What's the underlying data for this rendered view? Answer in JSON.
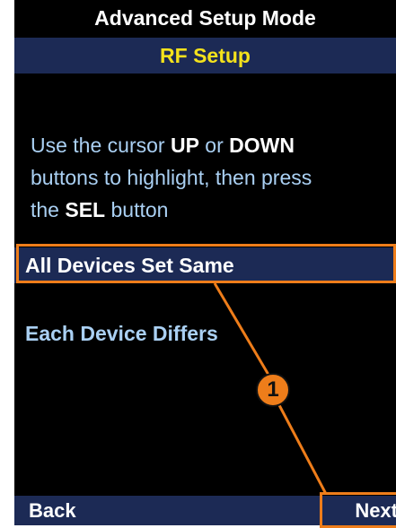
{
  "header": {
    "title": "Advanced Setup Mode",
    "subtitle": "RF Setup"
  },
  "instructions": {
    "line1_a": "Use the cursor ",
    "line1_up": "UP",
    "line1_or": " or ",
    "line1_down": "DOWN",
    "line2": "buttons to highlight, then press",
    "line3_a": "the ",
    "line3_sel": "SEL",
    "line3_b": " button"
  },
  "options": [
    {
      "label": "All Devices Set Same",
      "selected": true
    },
    {
      "label": "Each Device Differs",
      "selected": false
    }
  ],
  "softkeys": {
    "back": "Back",
    "next": "Next"
  },
  "callout": {
    "number": "1",
    "color": "#ee7d1a"
  },
  "colors": {
    "screen_bg": "#000000",
    "bar_bg": "#1c2a55",
    "title_yellow": "#f4e21c",
    "text_light_blue": "#aad0f3"
  }
}
